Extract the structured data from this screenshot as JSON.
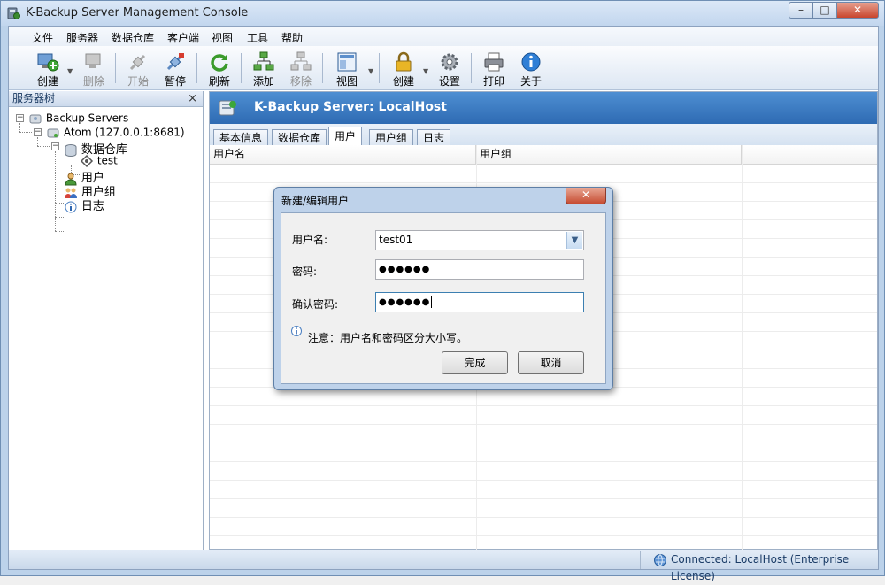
{
  "window": {
    "title": "K-Backup Server Management Console",
    "min": "–",
    "max": "□",
    "close": "✕"
  },
  "menu": [
    "文件",
    "服务器",
    "数据仓库",
    "客户端",
    "视图",
    "工具",
    "帮助"
  ],
  "toolbar": [
    {
      "label": "创建",
      "icon": "computer-add-icon",
      "enabled": true
    },
    {
      "label": "删除",
      "icon": "computer-delete-icon",
      "enabled": false
    },
    {
      "label": "开始",
      "icon": "satellite-start-icon",
      "enabled": false
    },
    {
      "label": "暂停",
      "icon": "satellite-pause-icon",
      "enabled": true
    },
    {
      "label": "刷新",
      "icon": "refresh-icon",
      "enabled": true
    },
    {
      "label": "添加",
      "icon": "network-add-icon",
      "enabled": true
    },
    {
      "label": "移除",
      "icon": "network-remove-icon",
      "enabled": false
    },
    {
      "label": "视图",
      "icon": "view-icon",
      "enabled": true
    },
    {
      "label": "创建",
      "icon": "lock-icon",
      "enabled": true
    },
    {
      "label": "设置",
      "icon": "gear-icon",
      "enabled": true
    },
    {
      "label": "打印",
      "icon": "printer-icon",
      "enabled": true
    },
    {
      "label": "关于",
      "icon": "info-icon",
      "enabled": true
    }
  ],
  "sidebar": {
    "title": "服务器树",
    "close": "×",
    "tree": [
      {
        "label": "Backup Servers",
        "icon": "servers-icon"
      },
      {
        "label": "Atom (127.0.0.1:8681)",
        "icon": "server-icon"
      },
      {
        "label": "数据仓库",
        "icon": "database-icon"
      },
      {
        "label": "test",
        "icon": "repository-icon"
      },
      {
        "label": "用户",
        "icon": "user-icon"
      },
      {
        "label": "用户组",
        "icon": "user-group-icon"
      },
      {
        "label": "日志",
        "icon": "log-info-icon"
      }
    ]
  },
  "main": {
    "banner_title": "K-Backup Server: LocalHost",
    "tabs": [
      "基本信息",
      "数据仓库",
      "用户",
      "用户组",
      "日志"
    ],
    "active_tab": "用户",
    "columns": [
      "用户名",
      "用户组"
    ]
  },
  "dialog": {
    "title": "新建/编辑用户",
    "close": "✕",
    "username_label": "用户名:",
    "username_value": "test01",
    "password_label": "密码:",
    "password_value": "●●●●●●",
    "confirm_label": "确认密码:",
    "confirm_value": "●●●●●●",
    "note": "注意：用户名和密码区分大小写。",
    "ok": "完成",
    "cancel": "取消"
  },
  "status": {
    "connection": "Connected: LocalHost (Enterprise License)"
  },
  "colors": {
    "banner": "#2e6bb3",
    "frame": "#bcd2ea",
    "close": "#c64c32"
  }
}
